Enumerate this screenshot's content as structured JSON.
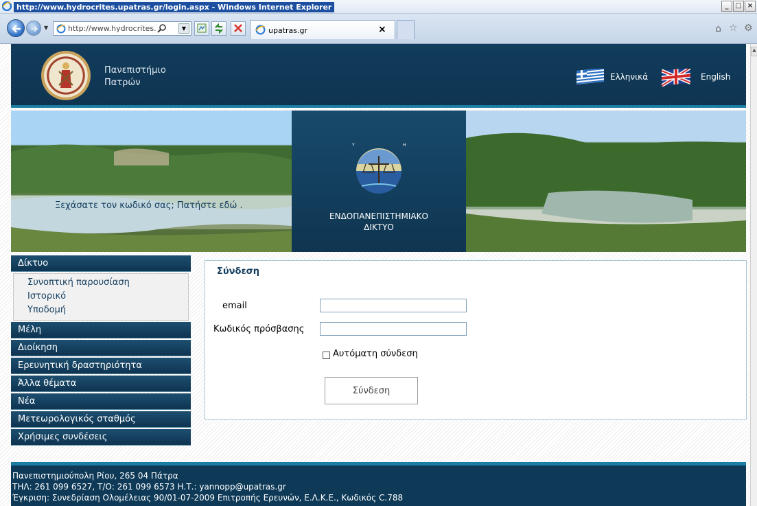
{
  "browser": {
    "window_title": "http://www.hydrocrites.upatras.gr/login.aspx - Windows Internet Explorer",
    "address": "http://www.hydrocrites.",
    "tab_title": "upatras.gr",
    "tab_close": "×",
    "window_buttons": [
      "_",
      "□",
      "×"
    ]
  },
  "header": {
    "university_line1": "Πανεπιστήμιο",
    "university_line2": "Πατρών",
    "lang_greek": "Ελληνικά",
    "lang_english": "English"
  },
  "banner": {
    "caption_line1": "ΕΝΔΟΠΑΝΕΠΙΣΤΗΜΙΑΚΟ",
    "caption_line2": "ΔΙΚΤΥΟ",
    "logo_left_text": "ΥΔΡΟΚΡΙΤΗΣ",
    "logo_right_text": "HYDROCRITES"
  },
  "sidebar": {
    "section_network": "Δίκτυο",
    "subitems": [
      "Συνοπτική παρουσίαση",
      "Ιστορικό",
      "Υποδομή"
    ],
    "items": [
      "Μέλη",
      "Διοίκηση",
      "Ερευνητική δραστηριότητα",
      "Άλλα θέματα",
      "Νέα",
      "Μετεωρολογικός σταθμός",
      "Χρήσιμες συνδέσεις"
    ]
  },
  "login": {
    "title": "Σύνδεση",
    "email_label": "email",
    "email_value": "",
    "password_label": "Κωδικός πρόσβασης",
    "password_value": "",
    "remember_label": "Αυτόματη σύνδεση",
    "remember_checked": false,
    "submit_label": "Σύνδεση",
    "forgot_text": "Ξεχάσατε τον κωδικό σας; Πατήστε ",
    "forgot_link": "εδώ",
    "forgot_suffix": " ."
  },
  "footer": {
    "line1": "Πανεπιστημιούπολη Ρίου, 265 04 Πάτρα",
    "line2": "ΤΗΛ: 261 099 6527, Τ/Ο: 261 099 6573 Η.Τ.: yannopp@upatras.gr",
    "line3": "Έγκριση: Συνεδρίαση Ολομέλειας 90/01-07-2009 Επιτροπής Ερευνών, Ε.Λ.Κ.Ε., Κωδικός C.788"
  },
  "colors": {
    "header_bg": "#123c5d",
    "accent": "#1a7ea3",
    "menu_text": "#ffffff",
    "submenu_text": "#123c5d"
  },
  "icons": [
    "ie-logo-icon",
    "back-arrow-icon",
    "forward-arrow-icon",
    "search-icon",
    "compatibility-icon",
    "refresh-icon",
    "stop-icon",
    "home-icon",
    "star-icon",
    "gear-icon",
    "greek-flag-icon",
    "uk-flag-icon"
  ]
}
